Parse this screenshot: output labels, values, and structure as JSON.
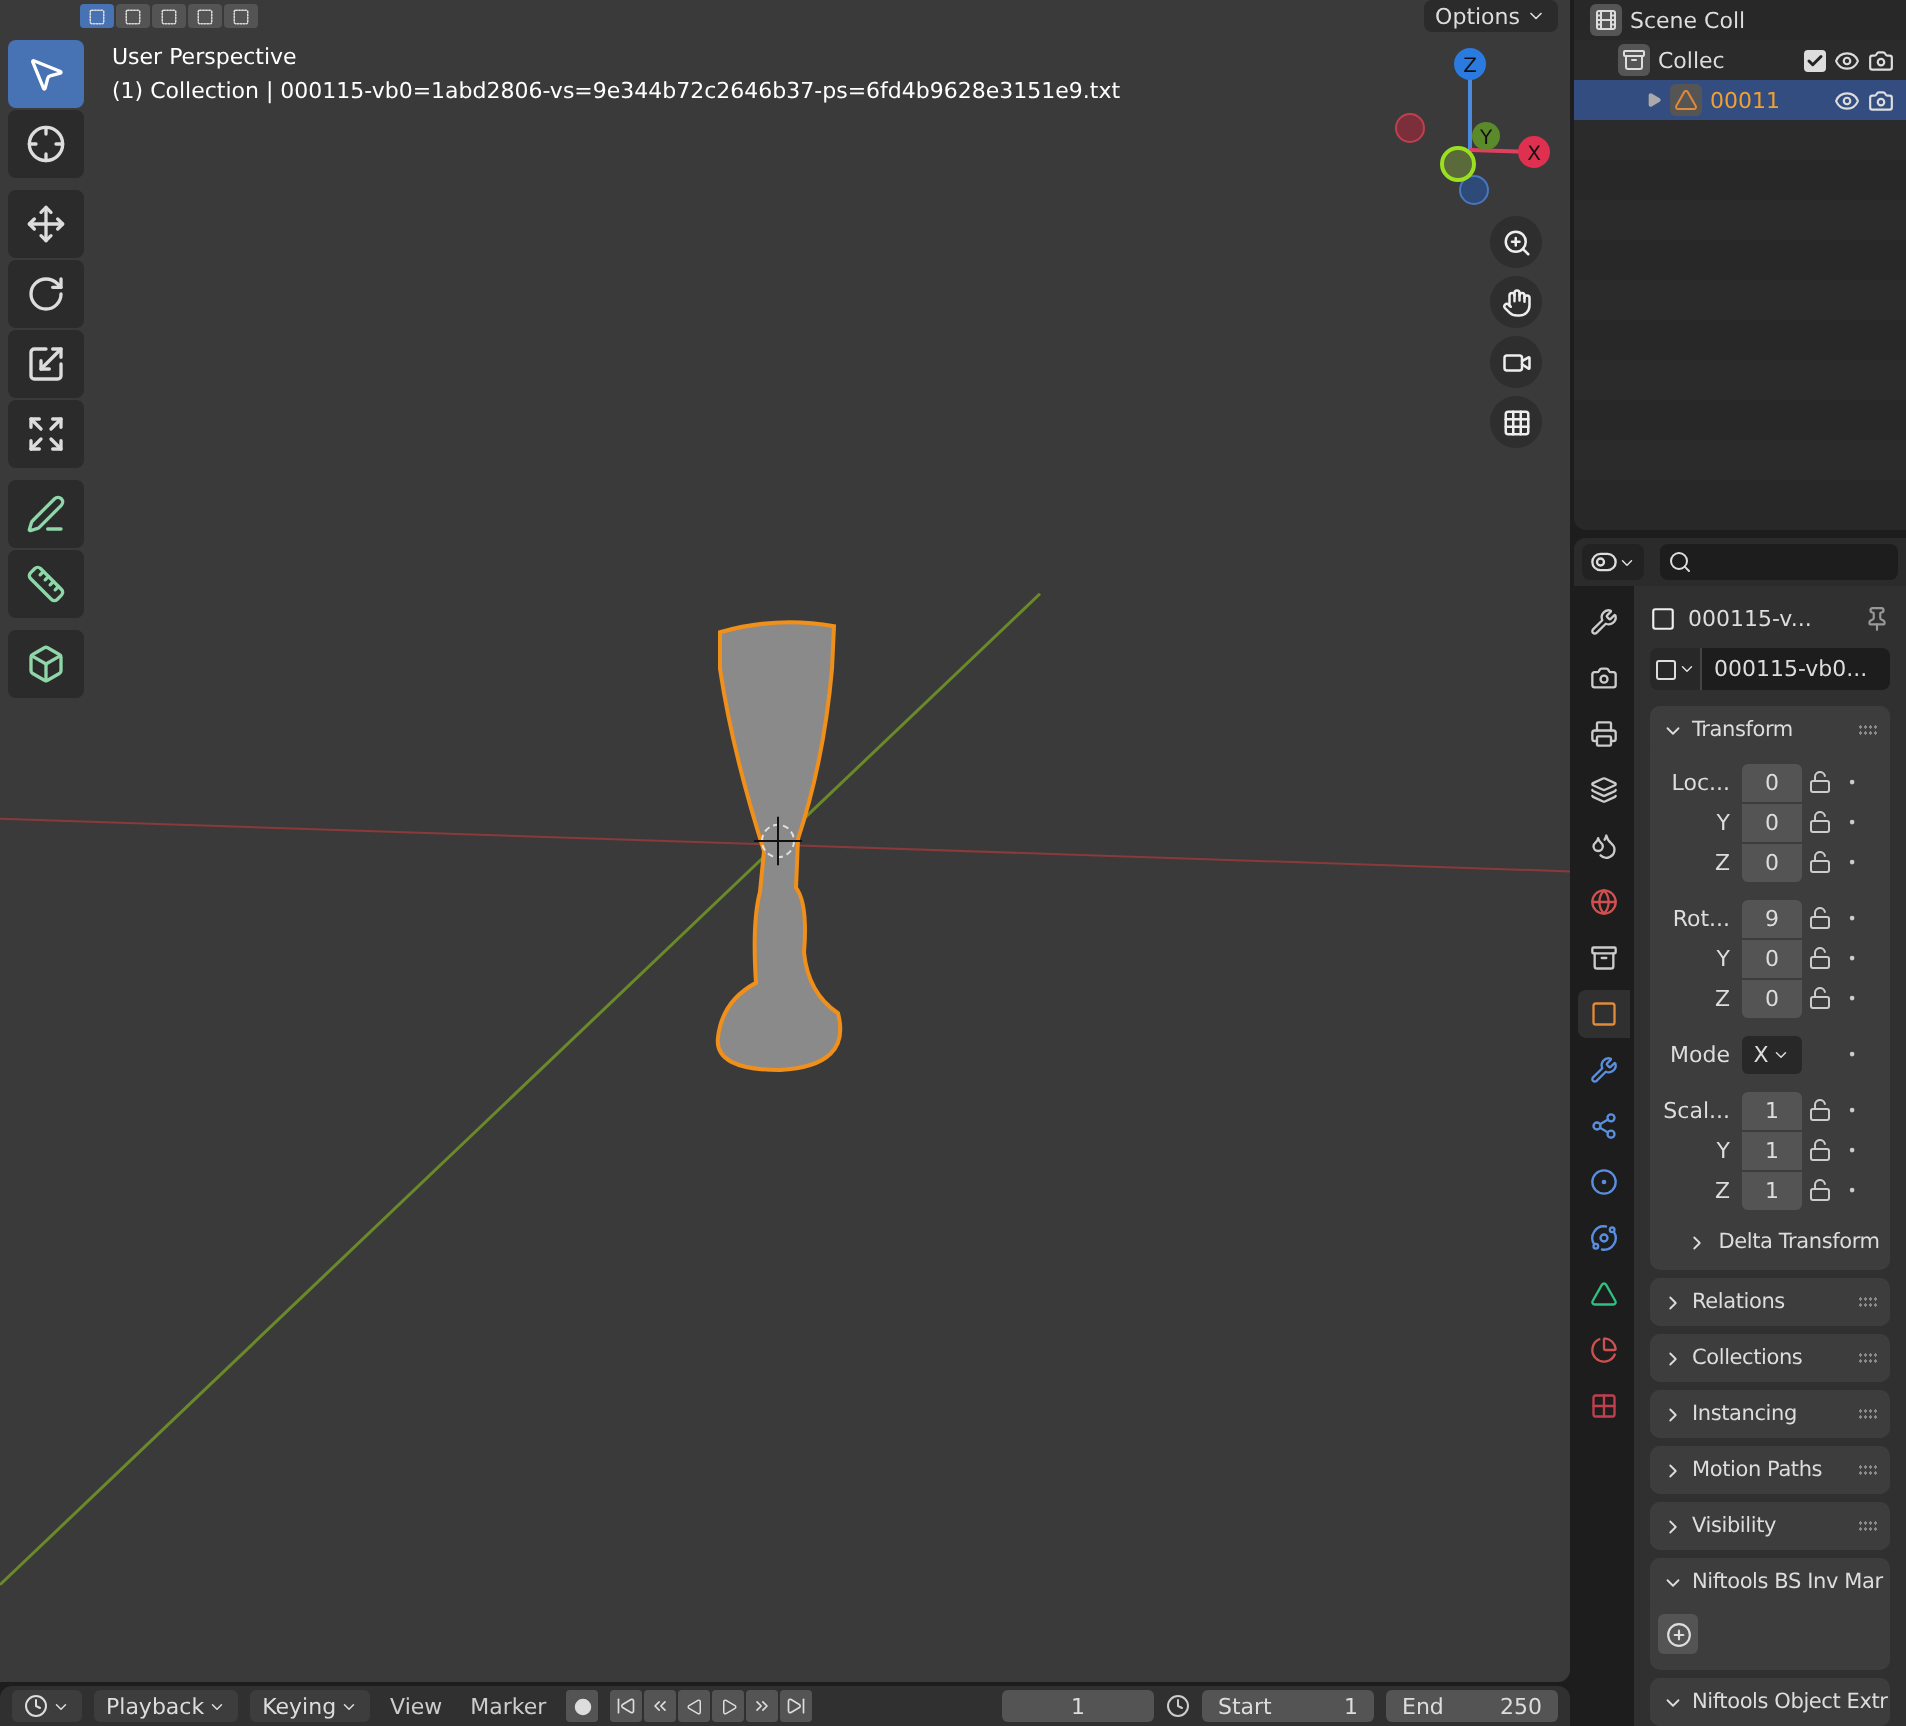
{
  "viewport": {
    "select_modes": [
      {
        "selected": true
      },
      {
        "selected": false
      },
      {
        "selected": false
      },
      {
        "selected": false
      },
      {
        "selected": false
      }
    ],
    "options": "Options",
    "view_name": "User Perspective",
    "object_info": "(1) Collection | 000115-vb0=1abd2806-vs=9e344b72c2646b37-ps=6fd4b9628e3151e9.txt",
    "tools": [
      {
        "kind": "select",
        "selected": true
      },
      {
        "kind": "cursor",
        "selected": false
      },
      {
        "kind": "move",
        "selected": false
      },
      {
        "kind": "rotate",
        "selected": false
      },
      {
        "kind": "scale",
        "selected": false
      },
      {
        "kind": "transform",
        "selected": false
      },
      {
        "kind": "annotate",
        "selected": false
      },
      {
        "kind": "measure",
        "selected": false
      },
      {
        "kind": "add_cube",
        "selected": false
      }
    ],
    "gizmo": {
      "z": "Z",
      "y": "Y",
      "x": "X"
    },
    "nav": [
      {
        "kind": "zoom"
      },
      {
        "kind": "pan"
      },
      {
        "kind": "camera"
      },
      {
        "kind": "grid"
      }
    ]
  },
  "outliner": {
    "items": [
      {
        "label": "Scene Coll",
        "kind": "scene",
        "selected": false,
        "children": [
          {
            "label": "Collec",
            "kind": "collection",
            "selected": false,
            "checked": true,
            "children": [
              {
                "label": "00011",
                "kind": "mesh",
                "selected": true,
                "expanded": false
              }
            ]
          }
        ]
      }
    ]
  },
  "properties": {
    "tabs": [
      {
        "kind": "tool",
        "selected": false
      },
      {
        "kind": "render",
        "selected": false
      },
      {
        "kind": "output",
        "selected": false
      },
      {
        "kind": "view_layer",
        "selected": false
      },
      {
        "kind": "scene",
        "selected": false
      },
      {
        "kind": "world",
        "selected": false
      },
      {
        "kind": "collection",
        "selected": false
      },
      {
        "kind": "object",
        "selected": true
      },
      {
        "kind": "modifiers",
        "selected": false
      },
      {
        "kind": "particles",
        "selected": false
      },
      {
        "kind": "physics",
        "selected": false
      },
      {
        "kind": "constraints",
        "selected": false
      },
      {
        "kind": "data",
        "selected": false
      },
      {
        "kind": "material",
        "selected": false
      },
      {
        "kind": "texture",
        "selected": false
      }
    ],
    "object_name": "000115-v...",
    "data_name": "000115-vb0...",
    "transform": {
      "title": "Transform",
      "expanded": true,
      "groups": [
        {
          "kind": "rows",
          "rows": [
            {
              "label": "Loc...",
              "value": "0"
            },
            {
              "label": "Y",
              "value": "0"
            },
            {
              "label": "Z",
              "value": "0"
            }
          ]
        },
        {
          "kind": "rows",
          "rows": [
            {
              "label": "Rot...",
              "value": "9"
            },
            {
              "label": "Y",
              "value": "0"
            },
            {
              "label": "Z",
              "value": "0"
            }
          ]
        },
        {
          "kind": "mode",
          "label": "Mode",
          "value": "X"
        },
        {
          "kind": "rows",
          "rows": [
            {
              "label": "Scal...",
              "value": "1"
            },
            {
              "label": "Y",
              "value": "1"
            },
            {
              "label": "Z",
              "value": "1"
            }
          ]
        }
      ],
      "subpanel": {
        "title": "Delta Transform",
        "expanded": false
      }
    },
    "panels": [
      {
        "title": "Relations",
        "expanded": false,
        "kind": "plain"
      },
      {
        "title": "Collections",
        "expanded": false,
        "kind": "plain"
      },
      {
        "title": "Instancing",
        "expanded": false,
        "kind": "plain"
      },
      {
        "title": "Motion Paths",
        "expanded": false,
        "kind": "plain"
      },
      {
        "title": "Visibility",
        "expanded": false,
        "kind": "plain"
      },
      {
        "title": "Niftools BS Inv Mar",
        "expanded": true,
        "kind": "add"
      },
      {
        "title": "Niftools Object Extr",
        "expanded": true,
        "kind": "plain"
      }
    ]
  },
  "timeline": {
    "menus": [
      "Playback",
      "Keying"
    ],
    "links": [
      "View",
      "Marker"
    ],
    "current_frame": "1",
    "start_label": "Start",
    "start": "1",
    "end_label": "End",
    "end": "250"
  }
}
